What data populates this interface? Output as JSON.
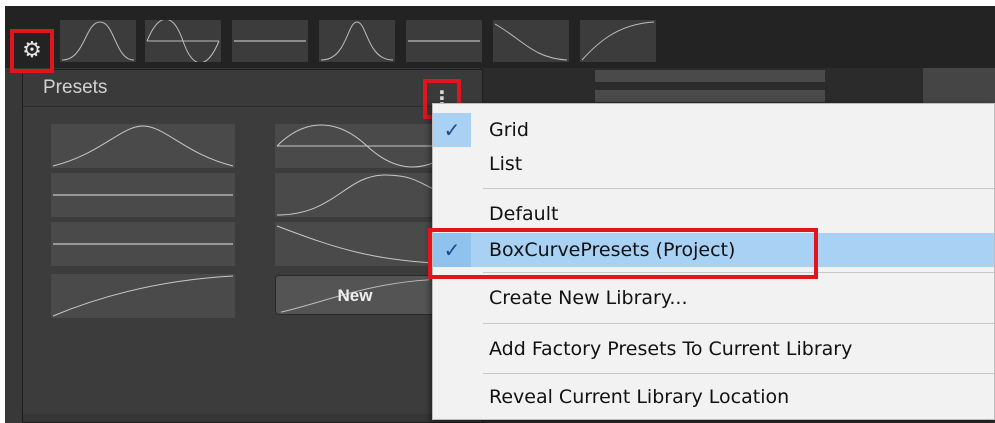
{
  "presets_panel": {
    "title": "Presets",
    "new_button_label": "New"
  },
  "context_menu": {
    "items": [
      {
        "label": "Grid",
        "checked": true
      },
      {
        "label": "List",
        "checked": false
      },
      {
        "label": "Default",
        "checked": false
      },
      {
        "label": "BoxCurvePresets (Project)",
        "checked": true,
        "selected": true
      },
      {
        "label": "Create New Library...",
        "checked": false
      },
      {
        "label": "Add Factory Presets To Current Library",
        "checked": false
      },
      {
        "label": "Reveal Current Library Location",
        "checked": false
      }
    ]
  },
  "icons": {
    "settings": "gear-icon",
    "options": "kebab-menu-icon",
    "check": "checkmark-icon"
  },
  "colors": {
    "highlight_border": "#e0151e",
    "menu_selected": "#a9d1f3",
    "check_color": "#1b4a8c",
    "panel_bg": "#3c3c3c",
    "curve_line": "#bdbdbd"
  }
}
